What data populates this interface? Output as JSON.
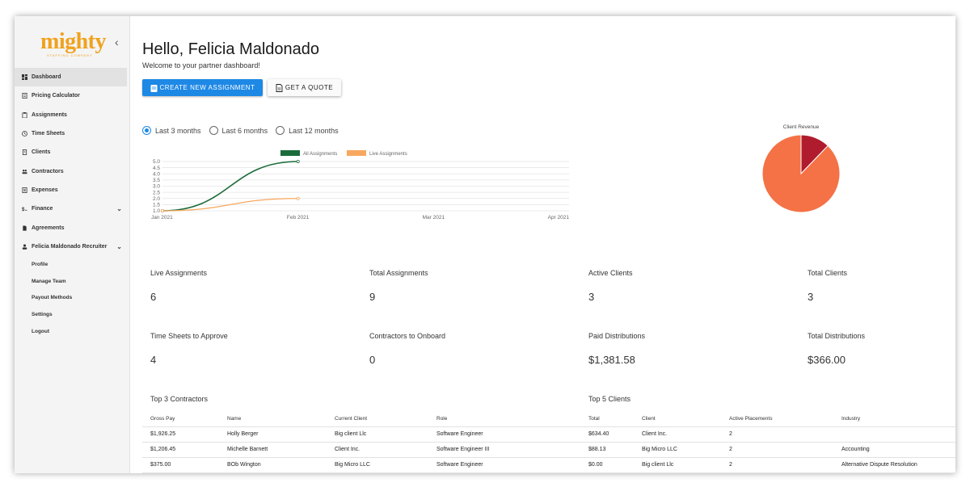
{
  "brand": {
    "logo": "mighty",
    "logo_sub": "STAFFING COMPANY",
    "color": "#f0a21e"
  },
  "sidebar": {
    "collapse_icon": "chevron-left-icon",
    "items": [
      {
        "label": "Dashboard",
        "icon": "dashboard-icon",
        "active": true
      },
      {
        "label": "Pricing Calculator",
        "icon": "calculator-icon"
      },
      {
        "label": "Assignments",
        "icon": "clipboard-icon"
      },
      {
        "label": "Time Sheets",
        "icon": "clock-icon"
      },
      {
        "label": "Clients",
        "icon": "building-icon"
      },
      {
        "label": "Contractors",
        "icon": "people-icon"
      },
      {
        "label": "Expenses",
        "icon": "receipt-icon"
      },
      {
        "label": "Finance",
        "icon": "finance-icon",
        "expandable": true
      },
      {
        "label": "Agreements",
        "icon": "document-icon"
      },
      {
        "label": "Felicia Maldonado Recruiter",
        "icon": "user-icon",
        "expandable": true
      }
    ],
    "sub_items": [
      "Profile",
      "Manage Team",
      "Payout Methods",
      "Settings",
      "Logout"
    ]
  },
  "header": {
    "greeting": "Hello, Felicia Maldonado",
    "welcome": "Welcome to your partner dashboard!",
    "primary_button": "CREATE NEW ASSIGNMENT",
    "secondary_button": "GET A QUOTE"
  },
  "range": {
    "options": [
      "Last 3 months",
      "Last 6 months",
      "Last 12 months"
    ],
    "selected": 0
  },
  "colors": {
    "accent": "#1e88e5",
    "all_series": "#1b6b3a",
    "live_series": "#f7a85e",
    "pie_main": "#f47246",
    "pie_small": "#b01c2e"
  },
  "chart_data": [
    {
      "type": "line",
      "categories": [
        "Jan 2021",
        "Feb 2021",
        "Mar 2021",
        "Apr 2021"
      ],
      "yticks": [
        "5.0",
        "4.5",
        "4.0",
        "3.5",
        "3.0",
        "2.5",
        "2.0",
        "1.5",
        "1.0"
      ],
      "ylim": [
        1.0,
        5.0
      ],
      "series": [
        {
          "name": "All Assignments",
          "values": [
            1,
            5
          ]
        },
        {
          "name": "Live Assignments",
          "values": [
            1,
            2
          ]
        }
      ],
      "legend": "top"
    },
    {
      "type": "pie",
      "title": "Client Revenue",
      "values": [
        634.4,
        88.13,
        0.0
      ]
    }
  ],
  "stats": [
    {
      "label": "Live Assignments",
      "value": "6"
    },
    {
      "label": "Total Assignments",
      "value": "9"
    },
    {
      "label": "Active Clients",
      "value": "3"
    },
    {
      "label": "Total Clients",
      "value": "3"
    },
    {
      "label": "Time Sheets to Approve",
      "value": "4"
    },
    {
      "label": "Contractors to Onboard",
      "value": "0"
    },
    {
      "label": "Paid Distributions",
      "value": "$1,381.58"
    },
    {
      "label": "Total Distributions",
      "value": "$366.00"
    }
  ],
  "contractors": {
    "title": "Top 3 Contractors",
    "columns": [
      "Gross Pay",
      "Name",
      "Current Client",
      "Role"
    ],
    "rows": [
      [
        "$1,926.25",
        "Holly Berger",
        "Big client Llc",
        "Software Engineer"
      ],
      [
        "$1,206.45",
        "Michelle Barnett",
        "Client Inc.",
        "Software Engineer III"
      ],
      [
        "$375.00",
        "BOb Wington",
        "Big Micro LLC",
        "Software Engineer"
      ]
    ]
  },
  "clients": {
    "title": "Top 5 Clients",
    "columns": [
      "Total",
      "Client",
      "Active Placements",
      "Industry"
    ],
    "rows": [
      [
        "$634.40",
        "Client Inc.",
        "2",
        ""
      ],
      [
        "$88.13",
        "Big Micro LLC",
        "2",
        "Accounting"
      ],
      [
        "$0.00",
        "Big client Llc",
        "2",
        "Alternative Dispute Resolution"
      ]
    ]
  }
}
